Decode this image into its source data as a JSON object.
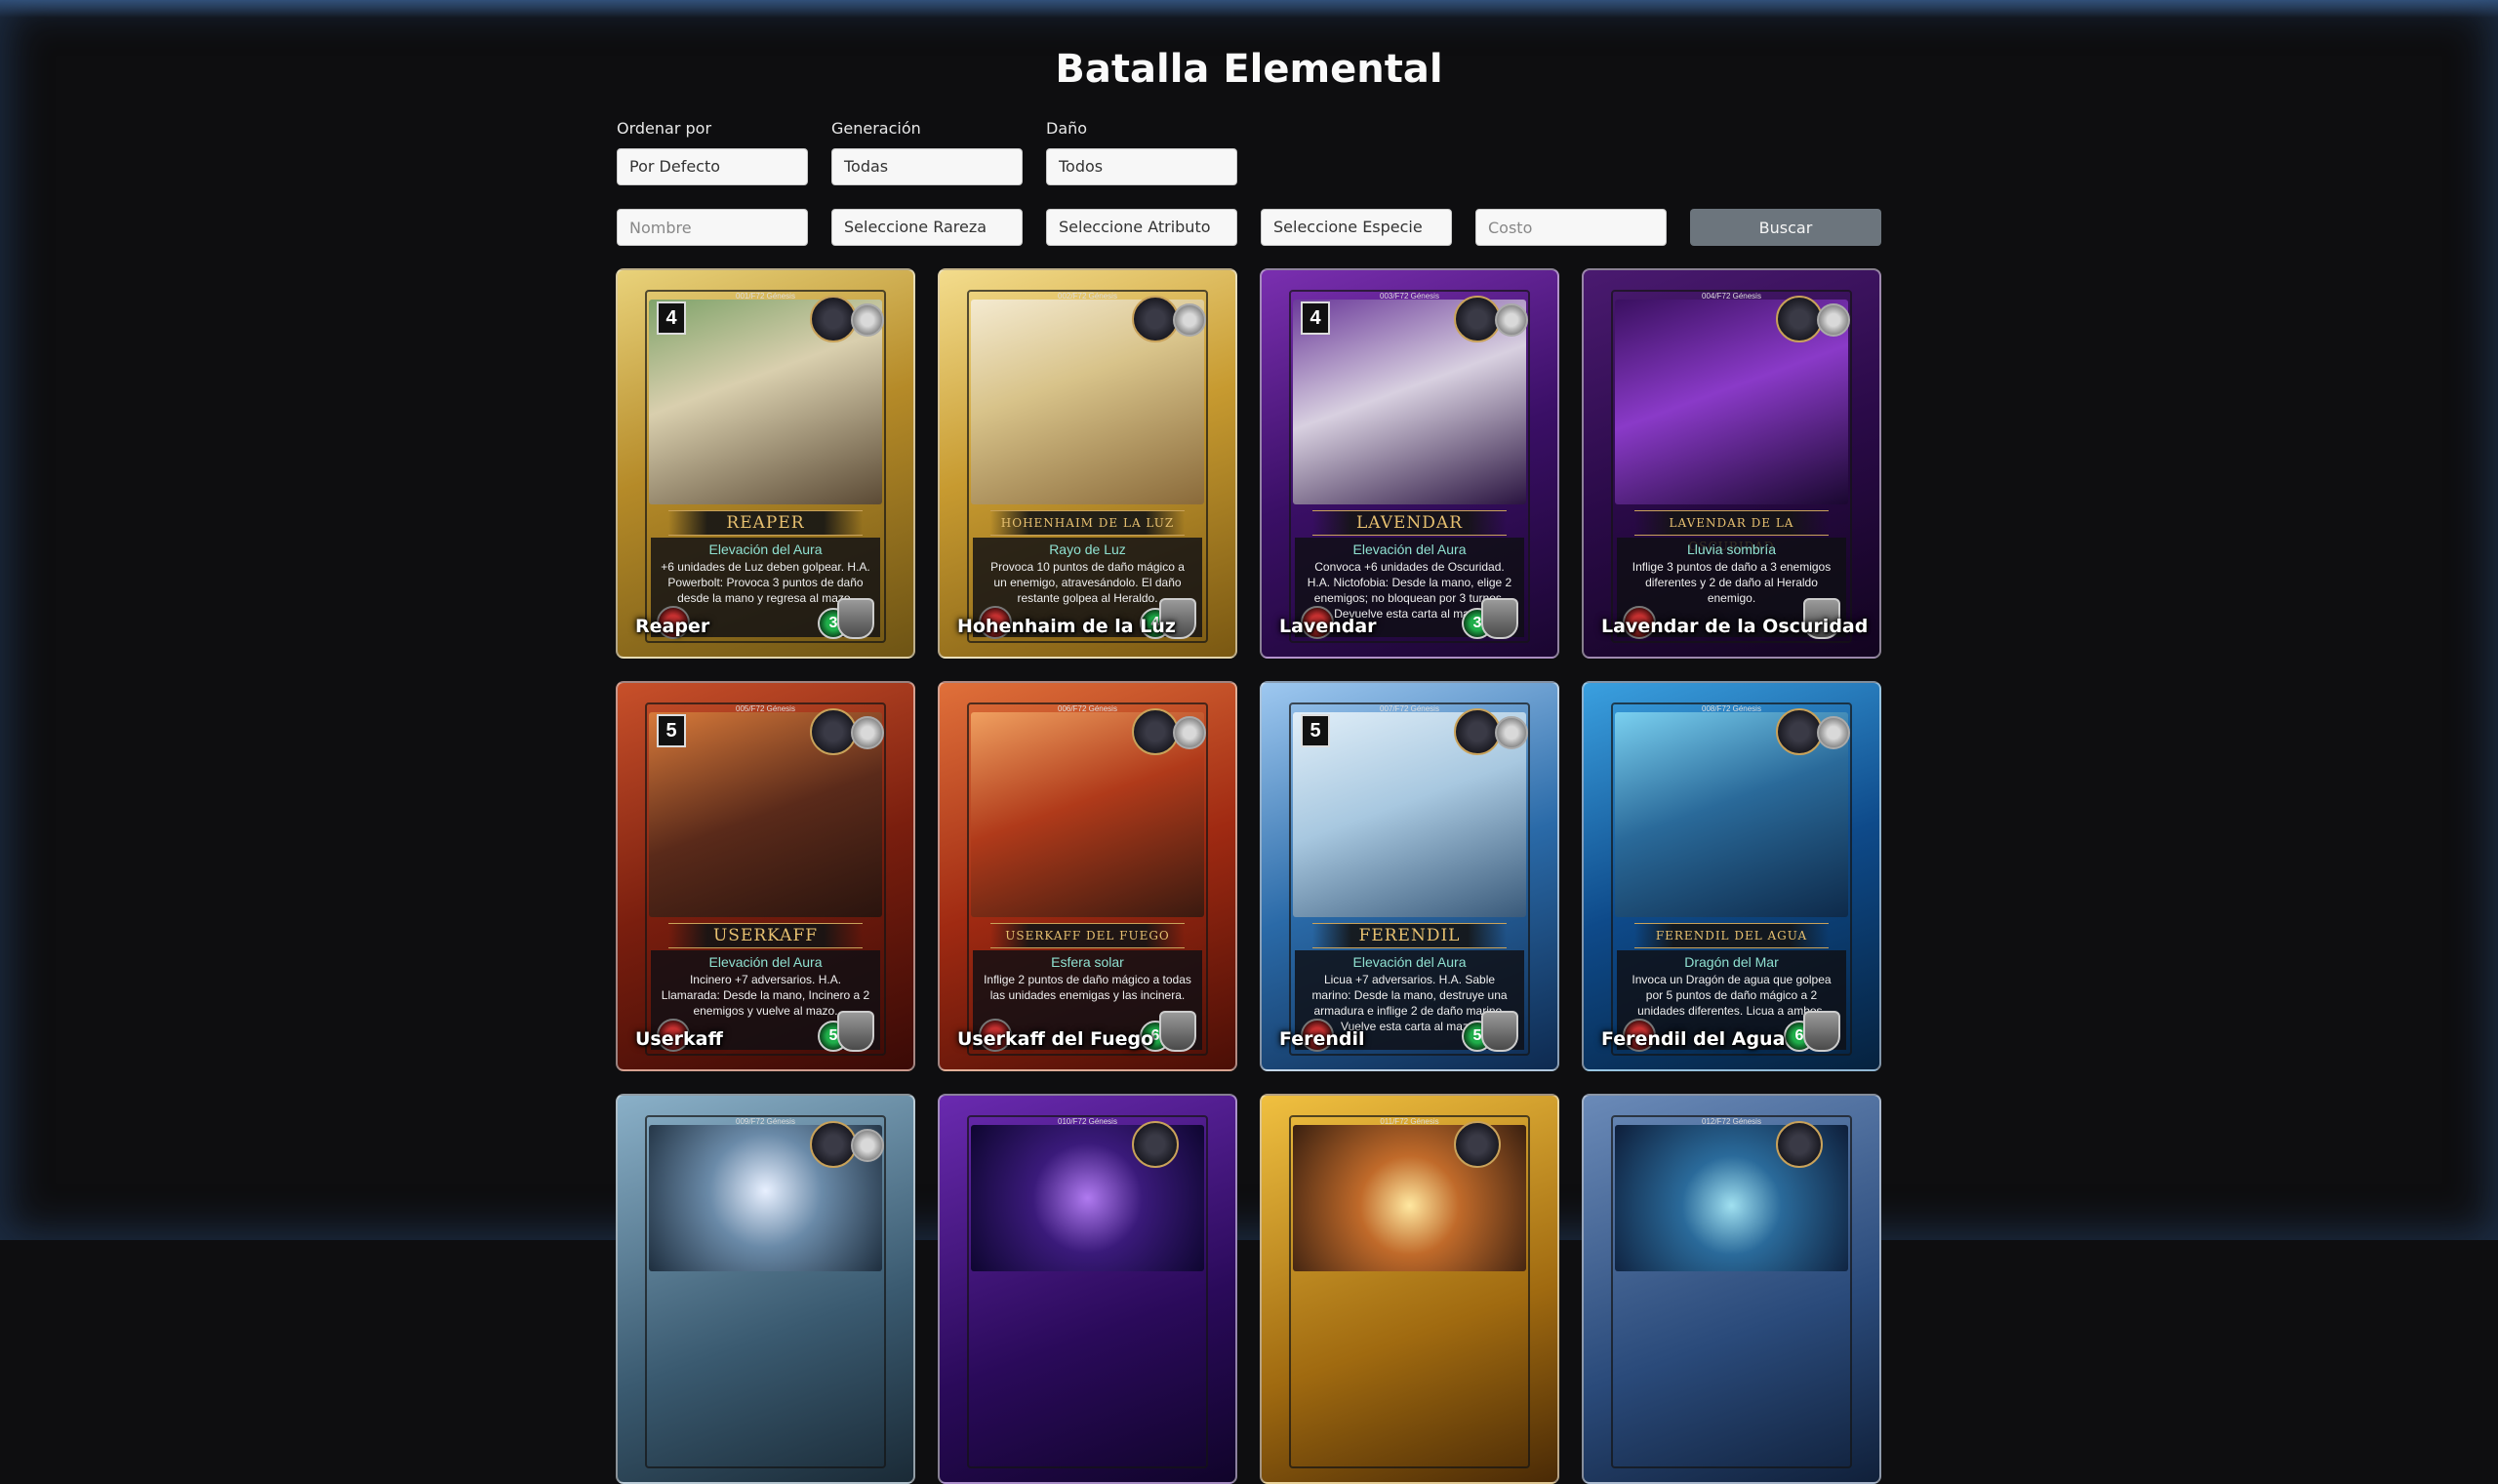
{
  "title": "Batalla Elemental",
  "filters": {
    "sort_label": "Ordenar por",
    "sort_value": "Por Defecto",
    "generation_label": "Generación",
    "generation_value": "Todas",
    "damage_label": "Daño",
    "damage_value": "Todos",
    "name_placeholder": "Nombre",
    "rarity_value": "Seleccione Rareza",
    "attribute_value": "Seleccione Atributo",
    "species_value": "Seleccione Especie",
    "cost_placeholder": "Costo",
    "search_label": "Buscar"
  },
  "cards": [
    {
      "caption": "Reaper",
      "banner": "REAPER",
      "cost": "4",
      "gem": "3",
      "meta": "001/F72 Génesis",
      "ability": "Elevación del Aura",
      "desc": "+6 unidades de Luz deben golpear. H.A. Powerbolt: Provoca 3 puntos de daño desde la mano y regresa al mazo.",
      "bg": "linear-gradient(160deg,#e9d27a,#b58a28 45%,#6e5414)",
      "art": "linear-gradient(160deg,#7fa36a,#d9cfae 40%,#5b4a35)"
    },
    {
      "caption": "Hohenhaim de la Luz",
      "banner": "HOHENHAIM DE LA LUZ",
      "cost": "",
      "gem": "4",
      "meta": "002/F72 Génesis",
      "ability": "Rayo de Luz",
      "desc": "Provoca 10 puntos de daño mágico a un enemigo, atravesándolo. El daño restante golpea al Heraldo.",
      "bg": "linear-gradient(160deg,#f3dc8c,#c79a30 45%,#7a5812)",
      "art": "linear-gradient(160deg,#f4ead0,#d8c38a 40%,#8a6a3a)"
    },
    {
      "caption": "Lavendar",
      "banner": "LAVENDAR",
      "cost": "4",
      "gem": "3",
      "meta": "003/F72 Génesis",
      "ability": "Elevación del Aura",
      "desc": "Convoca +6 unidades de Oscuridad. H.A. Nictofobia: Desde la mano, elige 2 enemigos; no bloquean por 3 turnos. Devuelve esta carta al mazo.",
      "bg": "linear-gradient(160deg,#7a2fb0,#3a0f66 50%,#1a0630)",
      "art": "linear-gradient(160deg,#6b3a9a,#d8d0e0 45%,#2a1440)"
    },
    {
      "caption": "Lavendar de la Oscuridad",
      "banner": "LAVENDAR DE LA OSCURIDAD",
      "cost": "",
      "gem": "",
      "meta": "004/F72 Génesis",
      "ability": "Lluvia sombría",
      "desc": "Inflige 3 puntos de daño a 3 enemigos diferentes y 2 de daño al Heraldo enemigo.",
      "bg": "linear-gradient(160deg,#4a1a70,#2a0a48 50%,#12041f)",
      "art": "linear-gradient(160deg,#3a1060,#8a3ac8 45%,#1a0830)"
    },
    {
      "caption": "Userkaff",
      "banner": "USERKAFF",
      "cost": "5",
      "gem": "5",
      "meta": "005/F72 Génesis",
      "ability": "Elevación del Aura",
      "desc": "Incinero +7 adversarios. H.A. Llamarada: Desde la mano, Incinero a 2 enemigos y vuelve al mazo.",
      "bg": "linear-gradient(160deg,#c8502a,#7a1e0e 50%,#3a0a06)",
      "art": "linear-gradient(160deg,#d87a3a,#5a2a1a 50%,#2a140e)"
    },
    {
      "caption": "Userkaff del Fuego",
      "banner": "USERKAFF DEL FUEGO",
      "cost": "",
      "gem": "6",
      "meta": "006/F72 Génesis",
      "ability": "Esfera solar",
      "desc": "Inflige 2 puntos de daño mágico a todas las unidades enemigas y las incinera.",
      "bg": "linear-gradient(160deg,#e0703a,#a02a12 50%,#4a0e06)",
      "art": "linear-gradient(160deg,#f0a060,#b03a1a 45%,#3a1a10)"
    },
    {
      "caption": "Ferendil",
      "banner": "FERENDIL",
      "cost": "5",
      "gem": "5",
      "meta": "007/F72 Génesis",
      "ability": "Elevación del Aura",
      "desc": "Licua +7 adversarios. H.A. Sable marino: Desde la mano, destruye una armadura e inflige 2 de daño marino. Vuelve esta carta al mazo.",
      "bg": "linear-gradient(160deg,#9ec8f0,#2a6aa8 50%,#0e2a50)",
      "art": "linear-gradient(160deg,#e0eef8,#a8c8e0 45%,#3a5a7a)"
    },
    {
      "caption": "Ferendil del Agua",
      "banner": "FERENDIL DEL AGUA",
      "cost": "",
      "gem": "6",
      "meta": "008/F72 Génesis",
      "ability": "Dragón del Mar",
      "desc": "Invoca un Dragón de agua que golpea por 5 puntos de daño mágico a 2 unidades diferentes. Licua a ambos.",
      "bg": "linear-gradient(160deg,#3aa0e0,#0e4a8a 50%,#06223f)",
      "art": "linear-gradient(160deg,#7ad0f0,#2a6a9a 45%,#0e2a4a)"
    },
    {
      "caption": "",
      "banner": "",
      "cost": "",
      "gem": "",
      "meta": "009/F72 Génesis",
      "ability": "",
      "desc": "",
      "bg": "linear-gradient(160deg,#8ab0c8,#3a5a70 60%,#1a2a36)",
      "art": "radial-gradient(circle at 50% 45%,#e8f0ff,#6a8aa8 40%,#1e2e3e)"
    },
    {
      "caption": "",
      "banner": "",
      "cost": "",
      "gem": "",
      "meta": "010/F72 Génesis",
      "ability": "",
      "desc": "",
      "bg": "linear-gradient(160deg,#6a2ab0,#2a0a5a 60%,#10042a)",
      "art": "radial-gradient(circle at 50% 50%,#b07af0,#3a1a7a 40%,#0e0630)"
    },
    {
      "caption": "",
      "banner": "",
      "cost": "",
      "gem": "",
      "meta": "011/F72 Génesis",
      "ability": "",
      "desc": "",
      "bg": "linear-gradient(160deg,#f0c040,#a06a10 60%,#4a2a06)",
      "art": "radial-gradient(circle at 50% 55%,#ffe8a0,#c06a2a 35%,#3a2010)"
    },
    {
      "caption": "",
      "banner": "",
      "cost": "",
      "gem": "",
      "meta": "012/F72 Génesis",
      "ability": "",
      "desc": "",
      "bg": "linear-gradient(160deg,#6a8ab8,#2a4a7a 60%,#10203a)",
      "art": "radial-gradient(circle at 50% 55%,#a0e0f0,#2a6a9a 35%,#0e1e3a)"
    }
  ]
}
